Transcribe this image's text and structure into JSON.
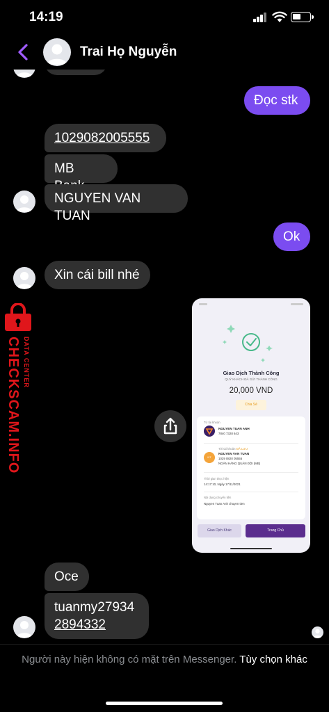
{
  "status_bar": {
    "time": "14:19"
  },
  "header": {
    "contact_name": "Trai Họ Nguyễn"
  },
  "messages": {
    "doc_stk": "Đọc stk",
    "account_number": "1029082005555",
    "bank": "MB Bank",
    "account_name": "NGUYEN VAN TUAN",
    "ok": "Ok",
    "xin_bill": "Xin cái bill nhé",
    "oce": "Oce",
    "tuanmy_line1": "tuanmy27934",
    "tuanmy_line2": "2894332"
  },
  "receipt": {
    "title": "Giao Dịch Thành Công",
    "subtitle": "QUÝ KHÁCH ĐÃ GỬI THÀNH CÔNG",
    "amount": "20,000 VND",
    "share_label": "Chia Sẻ",
    "from_label": "Từ tài khoản",
    "from_name": "NGUYEN TUAN ANH",
    "from_account": "7840 7328 643",
    "to_label": "Tới tài khoản",
    "saved_label": "ĐÃ LƯU",
    "to_initials": "NT",
    "to_name": "NGUYEN VAN TUAN",
    "to_account": "1029 0820 05555",
    "to_bank": "NGÂN HÀNG QUÂN ĐỘI (MB)",
    "time_label": "Thời gian thực hiện",
    "time_value": "14:17:10, Ngày 17/11/2021",
    "content_label": "Nội dung chuyển tiền",
    "content_value": "Nguyen Tuan Anh chuyen tien",
    "btn_other": "Giao Dịch Khác",
    "btn_home": "Trang Chủ"
  },
  "watermark": {
    "main": "CHECKSCAM.INFO",
    "small": "DATA CENTER"
  },
  "footer": {
    "text": "Người này hiện không có mặt trên Messenger.",
    "option": "Tùy chọn khác"
  },
  "colors": {
    "outgoing_bubble": "#7b4cf0",
    "incoming_bubble": "#303030",
    "back_arrow": "#a05cff",
    "watermark": "#e0161b"
  }
}
